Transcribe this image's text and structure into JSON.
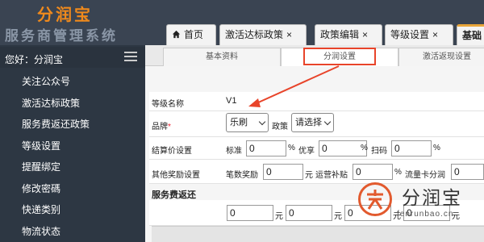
{
  "brand": {
    "name": "分润宝",
    "subtitle": "服务商管理系统",
    "accent": "#f08a1c"
  },
  "user": {
    "greeting": "您好：分润宝"
  },
  "sidebar": {
    "items": [
      {
        "label": "关注公众号"
      },
      {
        "label": "激活达标政策"
      },
      {
        "label": "服务费返还政策"
      },
      {
        "label": "等级设置"
      },
      {
        "label": "提醒绑定"
      },
      {
        "label": "修改密碼"
      },
      {
        "label": "快递类别"
      },
      {
        "label": "物流状态"
      }
    ]
  },
  "tabs": [
    {
      "label": "首页",
      "icon": "home-icon"
    },
    {
      "label": "激活达标政策",
      "close": "×"
    },
    {
      "label": "政策编辑",
      "close": "×"
    },
    {
      "label": "等级设置",
      "close": "×"
    },
    {
      "label": "基础"
    }
  ],
  "subtabs": [
    {
      "label": "基本资料"
    },
    {
      "label": "分润设置"
    },
    {
      "label": "激活返现设置"
    }
  ],
  "form": {
    "level_name_label": "等级名称",
    "level_name_value": "V1",
    "brand_label": "品牌",
    "brand_required": "*",
    "brand_value": "乐刷",
    "policy_label": "政策",
    "policy_value": "请选择",
    "settle_label": "结算价设置",
    "standard_label": "标准",
    "standard_value": "0",
    "standard_unit": "%",
    "youxiang_label": "优享",
    "youxiang_value": "0",
    "youxiang_unit": "%",
    "scan_label": "扫码",
    "scan_value": "0",
    "scan_unit": "%",
    "reward_label": "其他奖励设置",
    "pen_label": "笔数奖励",
    "pen_value": "0",
    "pen_unit": "元",
    "ops_label": "运营补贴",
    "ops_value": "0",
    "ops_unit": "%",
    "flow_label": "流量卡分润",
    "flow_value": "0",
    "service_section": "服务费返还",
    "svc1_value": "0",
    "svc1_unit": "元",
    "svc2_value": "0",
    "svc2_unit": "元",
    "svc3_value": "0",
    "svc3_unit": "元",
    "svc4_value": "0",
    "svc4_unit": "元"
  },
  "watermark": {
    "text": "分润宝",
    "url": "fenrunbao.cn",
    "color": "#e25a2e"
  },
  "annotation_color": "#e8442a"
}
